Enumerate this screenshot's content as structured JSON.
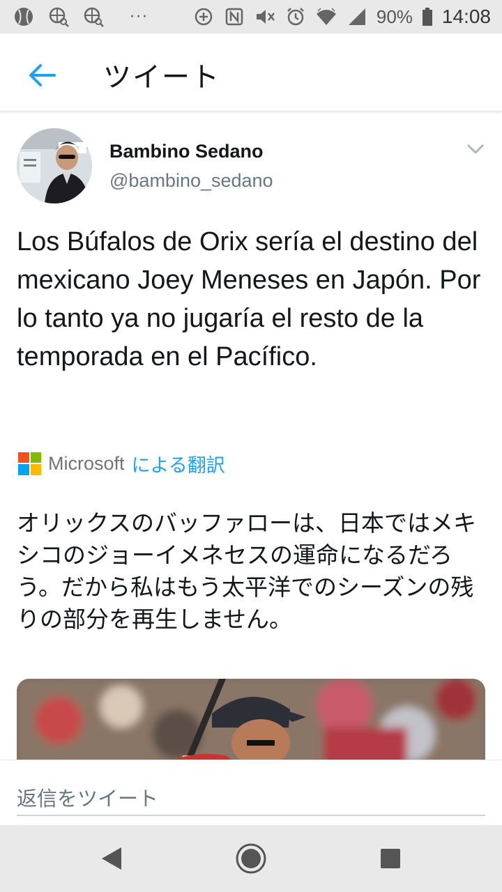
{
  "status_bar": {
    "icons_left": [
      "ball-icon",
      "globe-search-icon",
      "globe-search-icon"
    ],
    "overflow": "···",
    "icons_right": [
      "data-saver-icon",
      "nfc-icon",
      "mute-icon",
      "alarm-icon",
      "wifi-icon",
      "signal-icon"
    ],
    "battery": "90%",
    "time": "14:08"
  },
  "app_bar": {
    "title": "ツイート"
  },
  "tweet": {
    "author_name": "Bambino Sedano",
    "author_handle": "@bambino_sedano",
    "text": "Los Búfalos de Orix sería el destino del mexicano Joey Meneses en Japón. Por lo tanto ya no jugaría el resto de la temporada en el Pacífico.",
    "translation": {
      "provider": "Microsoft",
      "link_label": "による翻訳",
      "logo_colors": [
        "#f25022",
        "#7fba00",
        "#00a4ef",
        "#ffb900"
      ]
    },
    "translated_text": "オリックスのバッファローは、日本ではメキシコのジョーイメネセスの運命になるだろう。だから私はもう太平洋でのシーズンの残りの部分を再生しません。"
  },
  "reply": {
    "placeholder": "返信をツイート"
  },
  "colors": {
    "accent": "#1da1f2",
    "text_primary": "#14171a",
    "text_secondary": "#657786"
  }
}
